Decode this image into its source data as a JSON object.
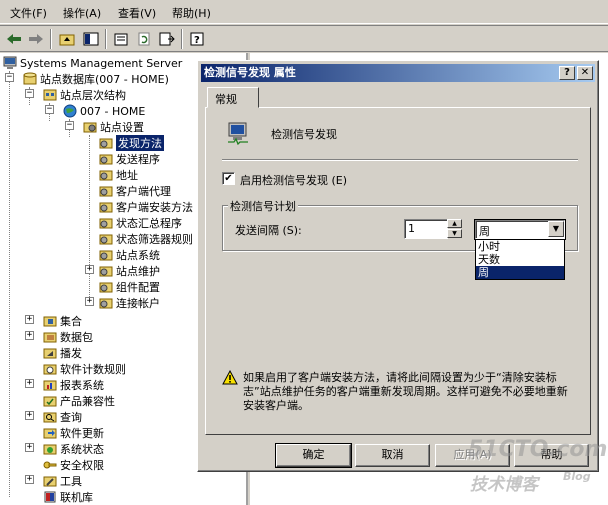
{
  "menu": [
    "文件(F)",
    "操作(A)",
    "查看(V)",
    "帮助(H)"
  ],
  "tree": {
    "root": "Systems Management Server",
    "site_db": "站点数据库(007 - HOME)",
    "hierarchy": "站点层次结构",
    "site": "007 - HOME",
    "site_settings": "站点设置",
    "settings_items": [
      "发现方法",
      "发送程序",
      "地址",
      "客户端代理",
      "客户端安装方法",
      "状态汇总程序",
      "状态筛选器规则",
      "站点系统",
      "站点维护",
      "组件配置",
      "连接帐户"
    ],
    "top_items": [
      "集合",
      "数据包",
      "播发",
      "软件计数规则",
      "报表系统",
      "产品兼容性",
      "查询",
      "软件更新",
      "系统状态",
      "安全权限",
      "工具",
      "联机库"
    ]
  },
  "dialog": {
    "title": "检测信号发现 属性",
    "tab": "常规",
    "heading": "检测信号发现",
    "enable_label": "启用检测信号发现 (E)",
    "enable_checked": true,
    "group_label": "检测信号计划",
    "interval_label": "发送间隔 (S):",
    "interval_value": "1",
    "unit_value": "周",
    "unit_options": [
      "小时",
      "天数",
      "周"
    ],
    "unit_selected": "周",
    "note": "如果启用了客户端安装方法，请将此间隔设置为少于“清除安装标志”站点维护任务的客户端重新发现周期。这样可避免不必要地重新安装客户端。",
    "buttons": {
      "ok": "确定",
      "cancel": "取消",
      "apply": "应用(A)",
      "help": "帮助"
    }
  },
  "watermark": {
    "site": "51CTO.com",
    "sub": "技术博客",
    "blog": "Blog"
  }
}
